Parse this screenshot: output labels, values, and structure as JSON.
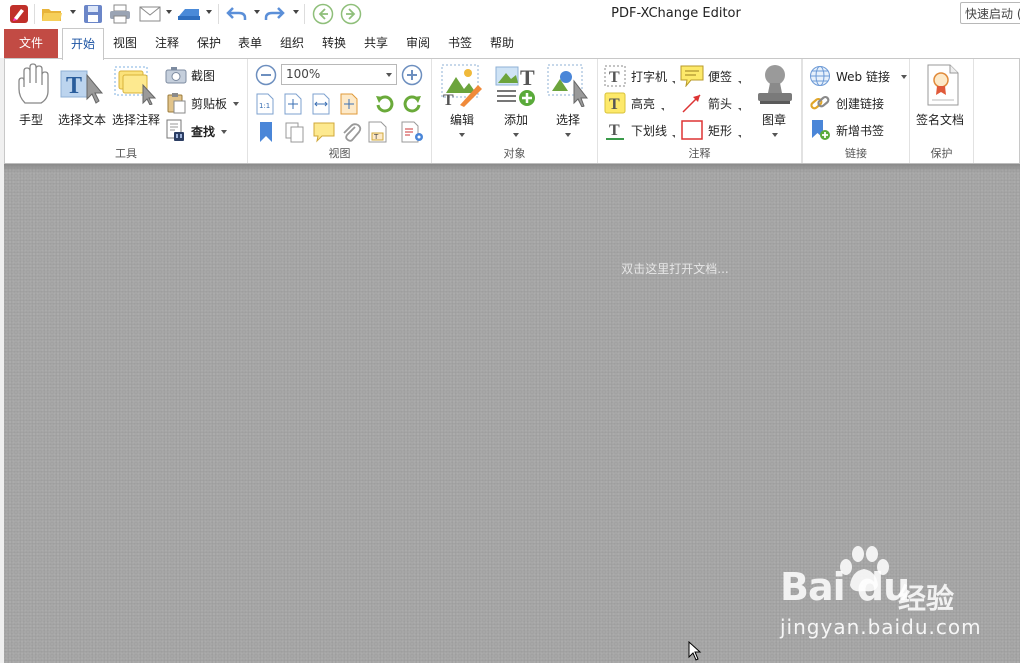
{
  "window": {
    "title": "PDF-XChange Editor",
    "quick_launch_placeholder": "快速启动 (C"
  },
  "tabs": [
    {
      "label": "文件"
    },
    {
      "label": "开始"
    },
    {
      "label": "视图"
    },
    {
      "label": "注释"
    },
    {
      "label": "保护"
    },
    {
      "label": "表单"
    },
    {
      "label": "组织"
    },
    {
      "label": "转换"
    },
    {
      "label": "共享"
    },
    {
      "label": "审阅"
    },
    {
      "label": "书签"
    },
    {
      "label": "帮助"
    }
  ],
  "ribbon": {
    "tools": {
      "label": "工具",
      "hand": "手型",
      "select_text": "选择文本",
      "select_annot": "选择注释",
      "snapshot": "截图",
      "clipboard": "剪贴板",
      "find": "查找"
    },
    "view": {
      "label": "视图",
      "zoom": "100%"
    },
    "objects": {
      "label": "对象",
      "edit": "编辑",
      "add": "添加",
      "select": "选择"
    },
    "comment": {
      "label": "注释",
      "typewriter": "打字机",
      "highlight": "高亮",
      "underline": "下划线",
      "sticky": "便签",
      "arrow": "箭头",
      "rectangle": "矩形"
    },
    "stamp": {
      "label": "图章"
    },
    "links": {
      "label": "链接",
      "web_links": "Web 链接",
      "create_link": "创建链接",
      "add_bookmark": "新增书签"
    },
    "protect": {
      "label": "保护",
      "sign": "签名文档"
    }
  },
  "workspace": {
    "hint": "双击这里打开文档..."
  },
  "watermark": {
    "logo": "Bai du",
    "brand_cn": "经验",
    "url": "jingyan.baidu.com"
  }
}
